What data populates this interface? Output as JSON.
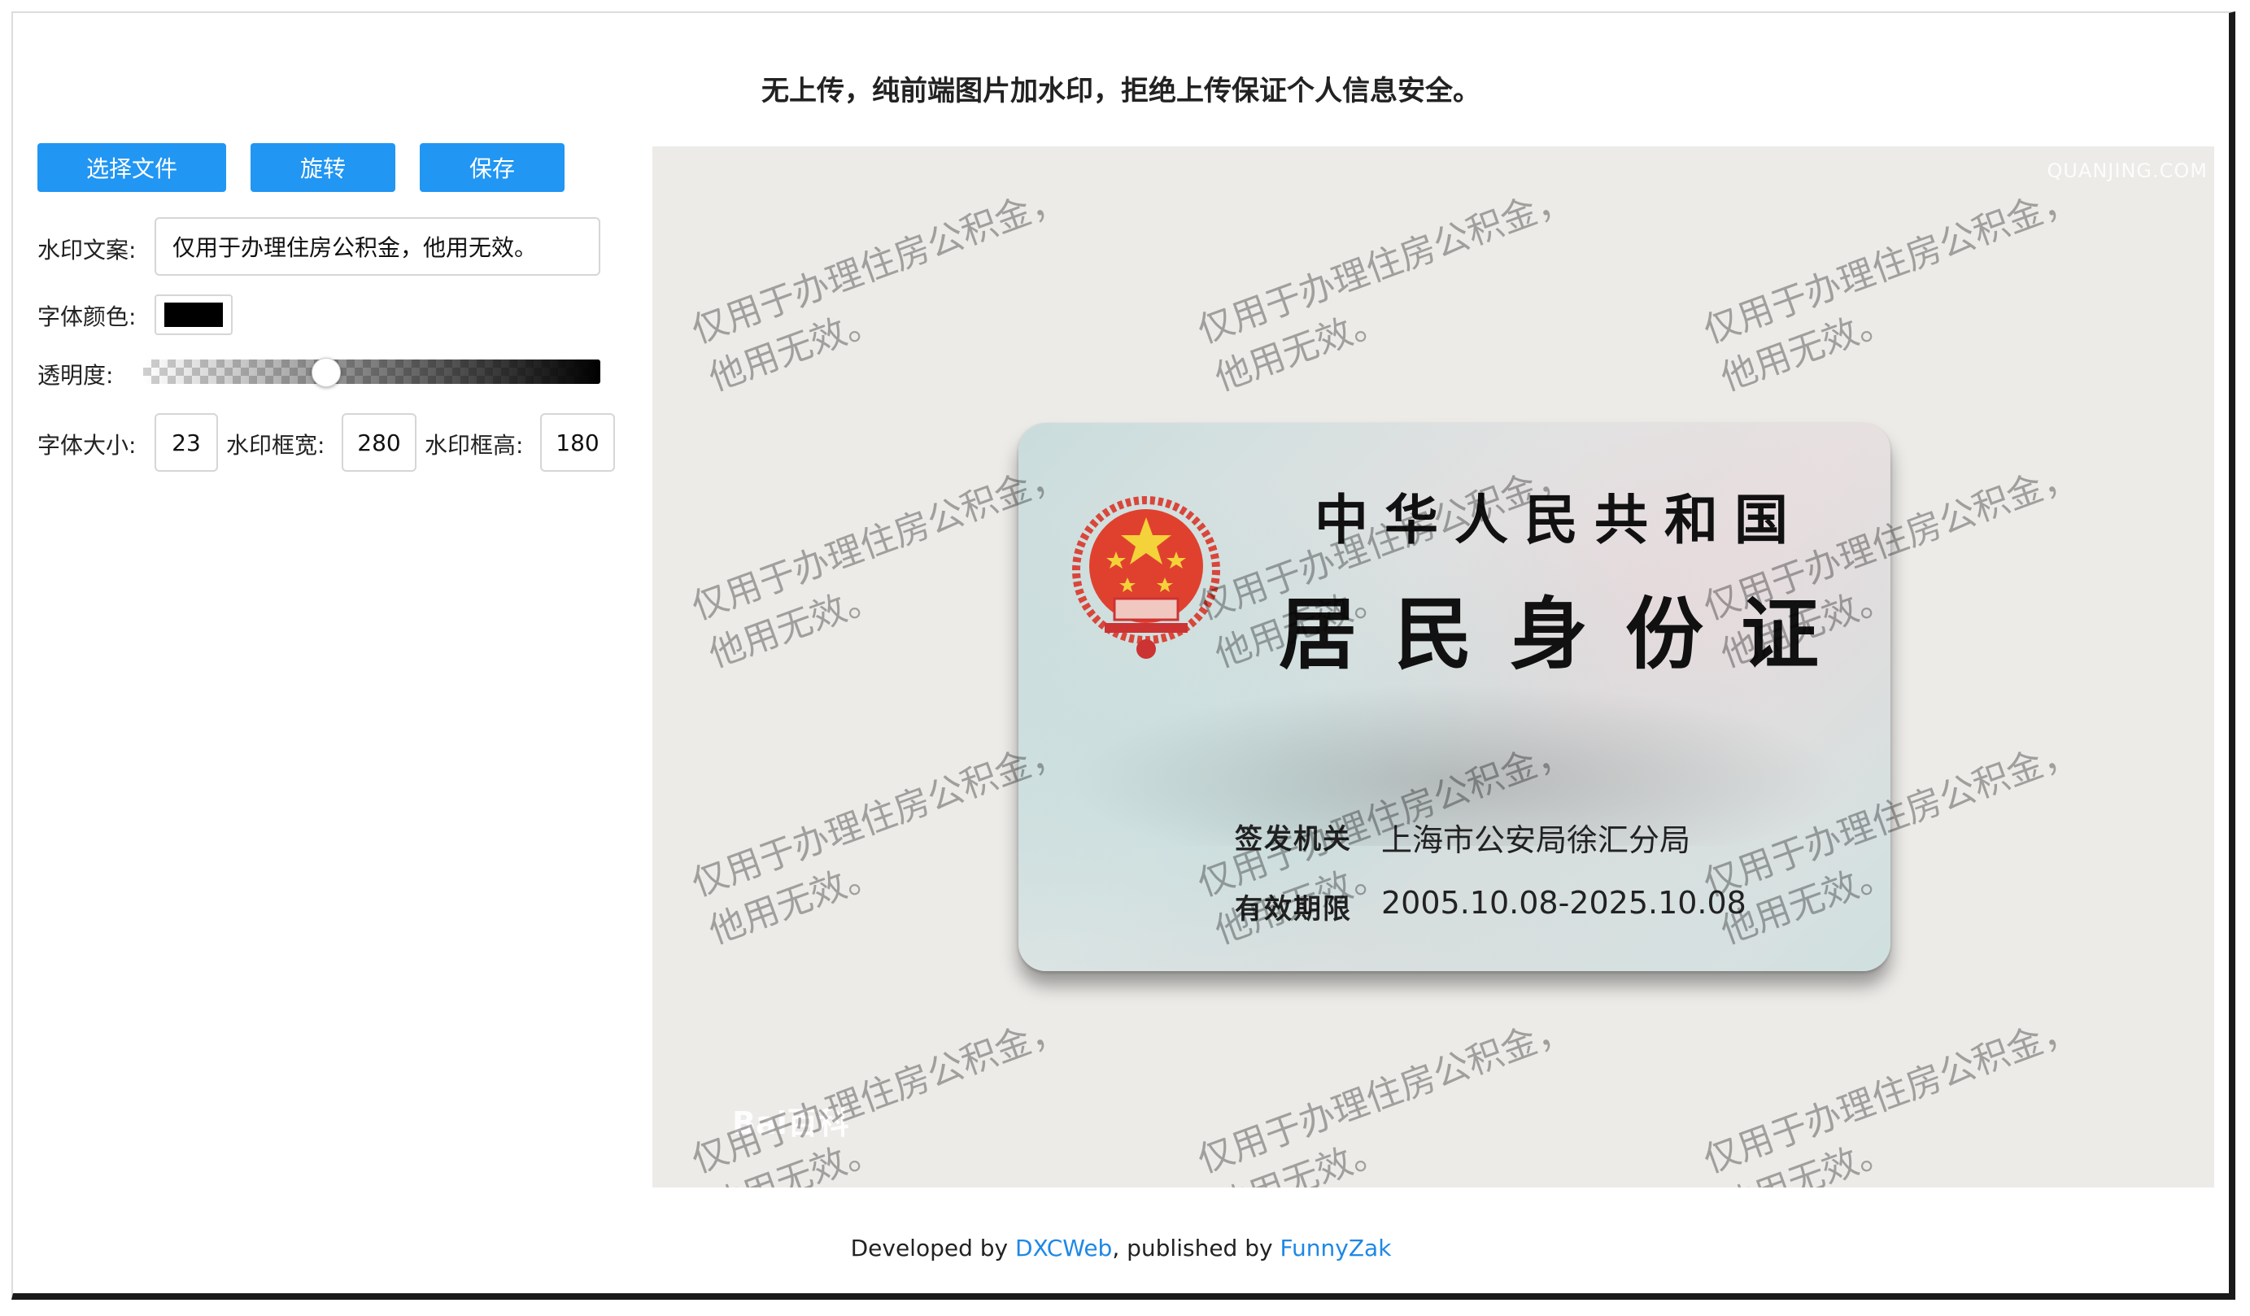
{
  "header": {
    "title": "无上传，纯前端图片加水印，拒绝上传保证个人信息安全。"
  },
  "toolbar": {
    "choose_file_label": "选择文件",
    "rotate_label": "旋转",
    "save_label": "保存"
  },
  "form": {
    "watermark_text_label": "水印文案:",
    "watermark_text_value": "仅用于办理住房公积金，他用无效。",
    "font_color_label": "字体颜色:",
    "font_color_value": "#000000",
    "opacity_label": "透明度:",
    "opacity_value": 0.4,
    "font_size_label": "字体大小:",
    "font_size_value": "23",
    "box_width_label": "水印框宽:",
    "box_width_value": "280",
    "box_height_label": "水印框高:",
    "box_height_value": "180"
  },
  "preview": {
    "site_watermark": "QUANJING.COM",
    "baidu_watermark": "Bai百科",
    "watermark_text": "仅用于办理住房公积金，他用无效。",
    "card": {
      "country": "中华人民共和国",
      "title": "居民身份证",
      "issuer_label": "签发机关",
      "issuer_value": "上海市公安局徐汇分局",
      "validity_label": "有效期限",
      "validity_value": "2005.10.08-2025.10.08"
    }
  },
  "footer": {
    "developed_by": "Developed by ",
    "developer": "DXCWeb",
    "published_by": ", published by ",
    "publisher": "FunnyZak"
  }
}
